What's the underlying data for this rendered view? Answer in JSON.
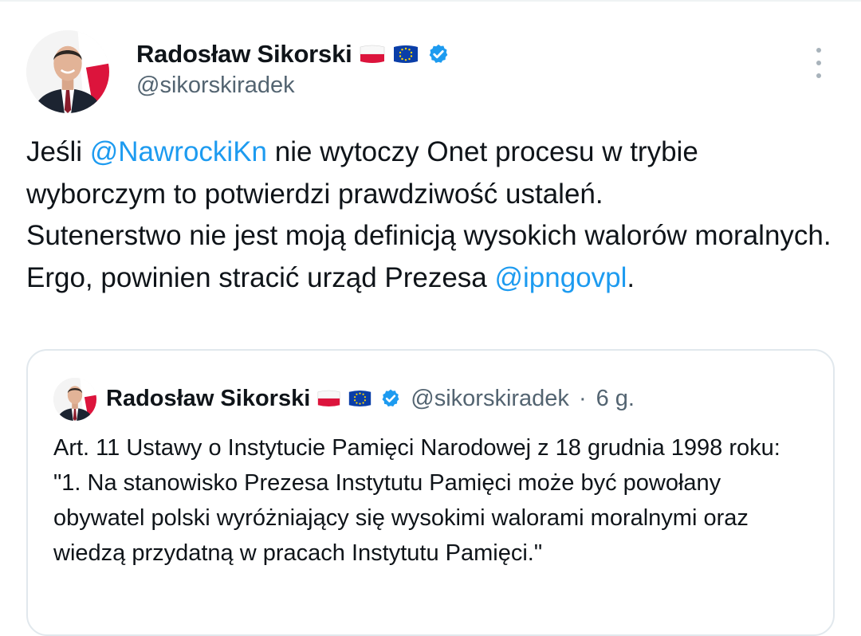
{
  "author": {
    "name": "Radosław Sikorski",
    "handle": "@sikorskiradek",
    "flags": [
      "poland-flag",
      "eu-flag"
    ],
    "verified": true
  },
  "tweet": {
    "pre_mention1": "Jeśli ",
    "mention1": "@NawrockiKn",
    "text1": " nie wytoczy Onet procesu w trybie wyborczym to potwierdzi prawdziwość ustaleń.",
    "line2": "Sutenerstwo nie jest moją definicją wysokich walorów moralnych.",
    "pre_mention2": "Ergo, powinien stracić urząd Prezesa ",
    "mention2": "@ipngovpl",
    "post_mention2": "."
  },
  "quoted": {
    "name": "Radosław Sikorski",
    "handle": "@sikorskiradek",
    "separator": "·",
    "time": "6 g.",
    "line1": "Art. 11 Ustawy o Instytucie Pamięci Narodowej z 18 grudnia 1998 roku:",
    "line2": "\"1. Na stanowisko Prezesa Instytutu Pamięci może być powołany obywatel polski wyróżniający się wysokimi walorami moralnymi oraz wiedzą przydatną w pracach Instytutu Pamięci.\""
  },
  "colors": {
    "link": "#1d9bf0",
    "verified": "#1d9bf0",
    "secondary_text": "#536471"
  },
  "icons": {
    "more": "more-vertical-icon",
    "verified": "verified-badge-icon"
  }
}
